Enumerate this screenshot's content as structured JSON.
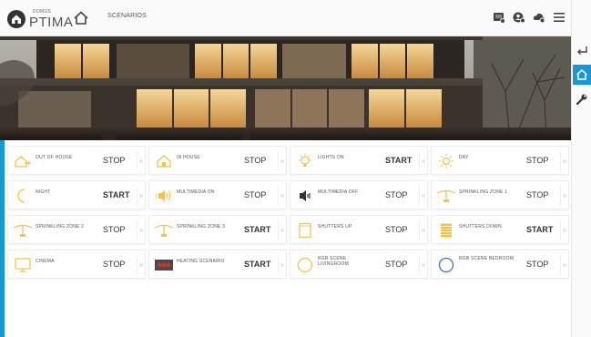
{
  "app": {
    "logo_small": "DOMUS",
    "logo_big": "PTIMA"
  },
  "header": {
    "breadcrumb": "SCENARIOS"
  },
  "colors": {
    "accent": "#1997d4",
    "icon_yellow": "#f3c24a",
    "icon_red": "#c0392b"
  },
  "scenarios": [
    {
      "name": "OUT OF HOUSE",
      "action": "STOP",
      "icon": "house-out-icon"
    },
    {
      "name": "IN HOUSE",
      "action": "STOP",
      "icon": "house-in-icon"
    },
    {
      "name": "LIGHTS ON",
      "action": "START",
      "icon": "light-bulb-icon"
    },
    {
      "name": "DAY",
      "action": "STOP",
      "icon": "sun-icon"
    },
    {
      "name": "NIGHT",
      "action": "START",
      "icon": "moon-icon"
    },
    {
      "name": "MULTIMEDIA ON",
      "action": "STOP",
      "icon": "speaker-on-icon"
    },
    {
      "name": "MULTIMEDIA OFF",
      "action": "STOP",
      "icon": "speaker-off-icon"
    },
    {
      "name": "SPRINKLING ZONE 1",
      "action": "STOP",
      "icon": "sprinkler-icon"
    },
    {
      "name": "SPRINKLING ZONE 2",
      "action": "STOP",
      "icon": "sprinkler-icon"
    },
    {
      "name": "SPRINKLING ZONE 3",
      "action": "START",
      "icon": "sprinkler-icon"
    },
    {
      "name": "SHUTTERS UP",
      "action": "STOP",
      "icon": "shutters-up-icon"
    },
    {
      "name": "SHUTTERS DOWN",
      "action": "START",
      "icon": "shutters-down-icon"
    },
    {
      "name": "CINEMA",
      "action": "STOP",
      "icon": "tv-icon"
    },
    {
      "name": "HEATING SCENARIO",
      "action": "START",
      "icon": "heater-icon"
    },
    {
      "name": "RGB SCENE LIVINGROOM",
      "action": "STOP",
      "icon": "rgb-circle-icon"
    },
    {
      "name": "RGB SCENE BEDROOM",
      "action": "STOP",
      "icon": "rgb-circle-icon"
    }
  ]
}
